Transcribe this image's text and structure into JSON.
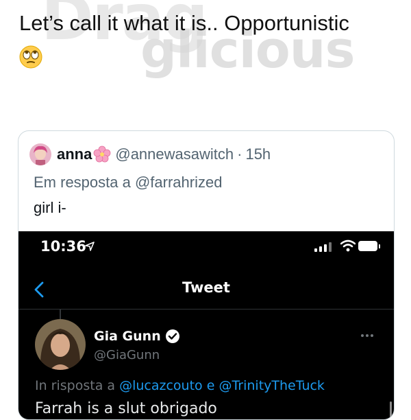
{
  "watermark": {
    "line1": "Drag",
    "line2": "glicious"
  },
  "post": {
    "text": "Let’s call it what it is.. Opportunistic",
    "emoji_icon": "face-with-rolling-eyes-icon"
  },
  "quoted_tweet": {
    "display_name": "anna",
    "name_emoji_icon": "cherry-blossom-icon",
    "handle": "@annewasawitch",
    "separator": "·",
    "time": "15h",
    "reply_to": "Em resposta a @farrahrized",
    "text": "girl i-"
  },
  "screenshot": {
    "status_time": "10:36",
    "nav_title": "Tweet",
    "author_name": "Gia Gunn",
    "author_handle": "@GiaGunn",
    "reply_prefix": "In risposta a",
    "reply_mention_1": "@lucazcouto",
    "reply_conjunction": "e",
    "reply_mention_2": "@TrinityTheTuck",
    "tweet_text": "Farrah is a slut obrigado"
  },
  "colors": {
    "link": "#1d9bf0",
    "secondary_text": "#536471",
    "border": "#cfd9de",
    "dark_bg": "#000000"
  }
}
